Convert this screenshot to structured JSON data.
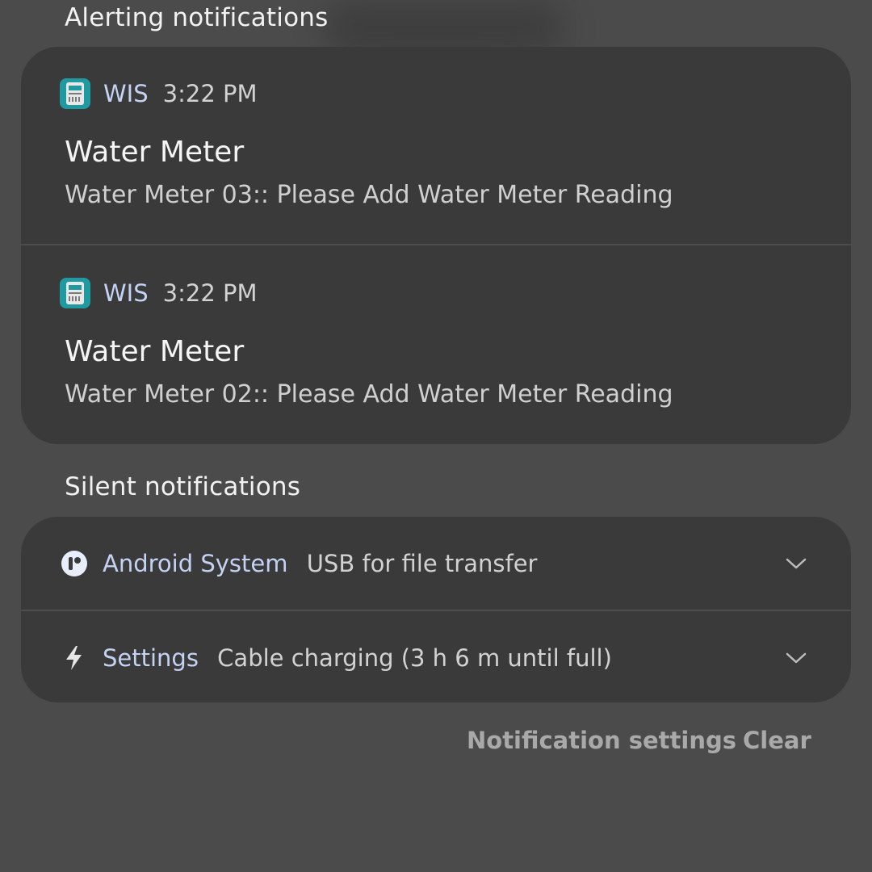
{
  "alerting": {
    "title": "Alerting notifications",
    "notifications": [
      {
        "app": "WIS",
        "time": "3:22 PM",
        "title": "Water Meter",
        "text": "Water Meter 03:: Please Add Water Meter Reading",
        "icon": "water-meter-icon"
      },
      {
        "app": "WIS",
        "time": "3:22 PM",
        "title": "Water Meter",
        "text": "Water Meter 02:: Please Add Water Meter Reading",
        "icon": "water-meter-icon"
      }
    ]
  },
  "silent": {
    "title": "Silent notifications",
    "notifications": [
      {
        "app": "Android System",
        "text": "USB for file transfer",
        "icon": "android-system-icon"
      },
      {
        "app": "Settings",
        "text": "Cable charging (3 h 6 m until full)",
        "icon": "lightning-bolt-icon"
      }
    ]
  },
  "footer": {
    "settings_label": "Notification settings",
    "clear_label": "Clear"
  },
  "colors": {
    "background": "#4b4b4b",
    "card": "#3a3a3a",
    "app_name": "#c4d3f4",
    "app_icon": "#1e9aa0",
    "footer_text": "#a9a9a9"
  }
}
